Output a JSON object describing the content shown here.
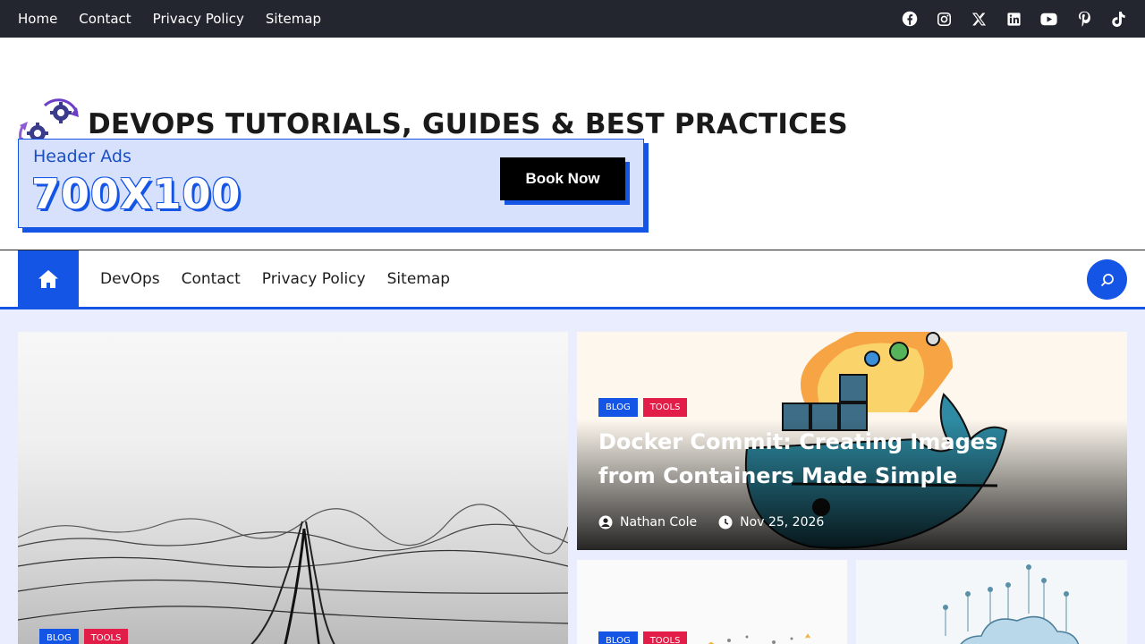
{
  "topbar": {
    "links": [
      "Home",
      "Contact",
      "Privacy Policy",
      "Sitemap"
    ],
    "social": [
      "facebook-icon",
      "instagram-icon",
      "x-icon",
      "linkedin-icon",
      "youtube-icon",
      "pinterest-icon",
      "tiktok-icon"
    ]
  },
  "site": {
    "title": "DEVOPS TUTORIALS, GUIDES & BEST PRACTICES"
  },
  "ad": {
    "title": "Header Ads",
    "size": "700X100",
    "button": "Book Now"
  },
  "mainnav": {
    "items": [
      "DevOps",
      "Contact",
      "Privacy Policy",
      "Sitemap"
    ]
  },
  "posts": {
    "featured": {
      "categories": [
        "BLOG",
        "TOOLS"
      ]
    },
    "right": {
      "categories": [
        "BLOG",
        "TOOLS"
      ],
      "title": "Docker Commit: Creating Images from Containers Made Simple",
      "author": "Nathan Cole",
      "date": "Nov 25, 2026"
    },
    "small1": {
      "categories": [
        "BLOG",
        "TOOLS"
      ]
    }
  },
  "colors": {
    "accent": "#1455e6",
    "tools": "#e11d48",
    "topbar": "#23252f"
  }
}
